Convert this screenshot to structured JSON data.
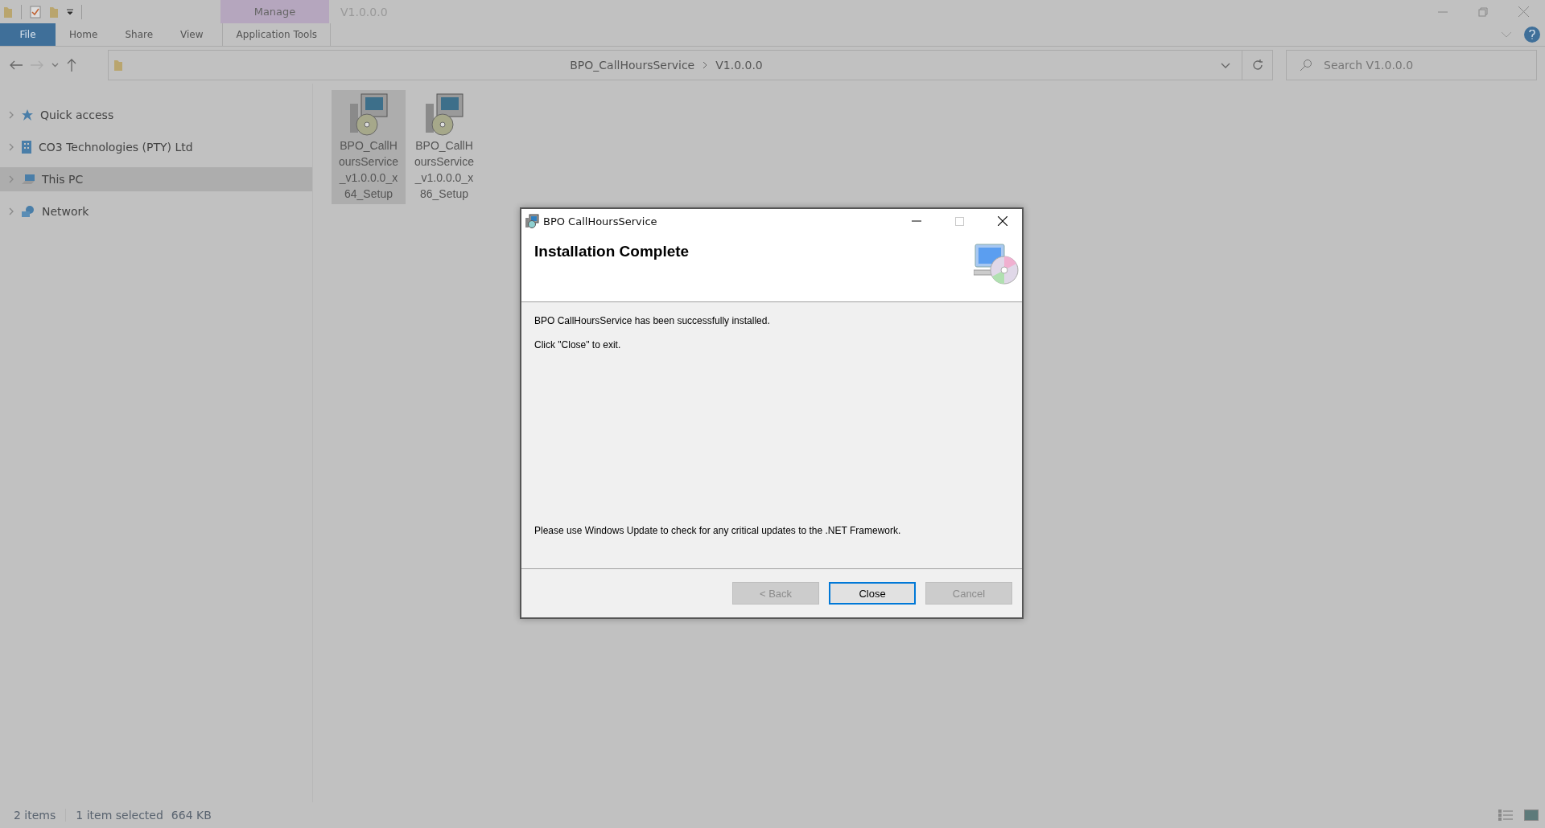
{
  "explorer": {
    "context_group": "Manage",
    "window_title": "V1.0.0.0",
    "ribbon_tabs": [
      {
        "label": "File",
        "kind": "file"
      },
      {
        "label": "Home",
        "kind": "plain"
      },
      {
        "label": "Share",
        "kind": "plain"
      },
      {
        "label": "View",
        "kind": "plain"
      },
      {
        "label": "Application Tools",
        "kind": "contextual"
      }
    ],
    "address_path": [
      "BPO_CallHoursService",
      "V1.0.0.0"
    ],
    "search": {
      "placeholder": "Search V1.0.0.0"
    },
    "sidebar": [
      {
        "label": "Quick access",
        "kind": "star",
        "selected": false
      },
      {
        "label": "CO3 Technologies (PTY) Ltd",
        "kind": "building",
        "selected": false
      },
      {
        "label": "This PC",
        "kind": "pc",
        "selected": true
      },
      {
        "label": "Network",
        "kind": "network",
        "selected": false
      }
    ],
    "files": [
      {
        "name": "BPO_CallHoursService_v1.0.0.0_x64_Setup",
        "selected": true
      },
      {
        "name": "BPO_CallHoursService_v1.0.0.0_x86_Setup",
        "selected": false
      }
    ],
    "status_bar": {
      "item_count": "2 items",
      "selection": "1 item selected",
      "size": "664 KB"
    }
  },
  "dialog": {
    "title": "BPO CallHoursService",
    "heading": "Installation Complete",
    "messages": [
      "BPO CallHoursService has been successfully installed.",
      "Click \"Close\" to exit."
    ],
    "footer_note": "Please use Windows Update to check for any critical updates to the .NET Framework.",
    "buttons": [
      {
        "label": "< Back",
        "disabled": true,
        "focused": false
      },
      {
        "label": "Close",
        "disabled": false,
        "focused": true
      },
      {
        "label": "Cancel",
        "disabled": true,
        "focused": false
      }
    ]
  }
}
